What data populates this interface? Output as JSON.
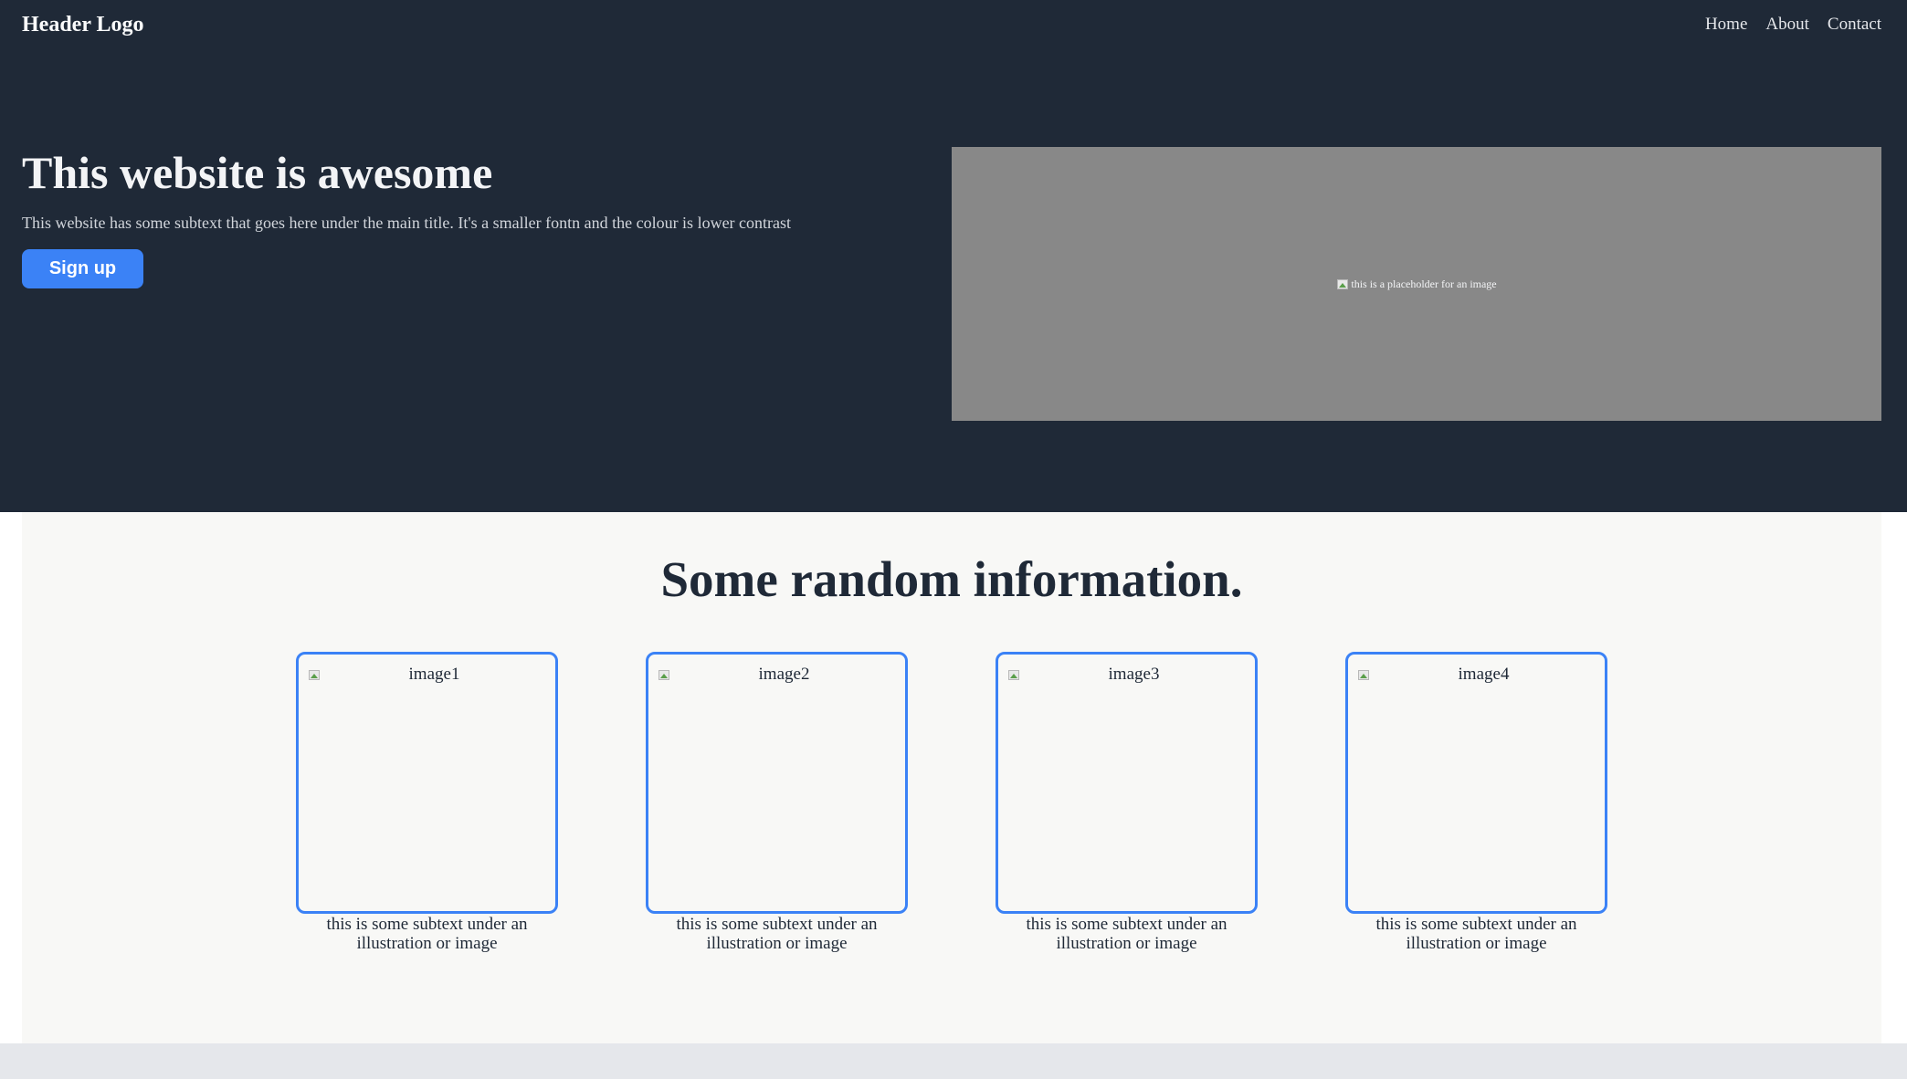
{
  "header": {
    "logo": "Header Logo",
    "nav": [
      "Home",
      "About",
      "Contact"
    ]
  },
  "hero": {
    "title": "This website is awesome",
    "subtitle": "This website has some subtext that goes here under the main title. It's a smaller fontn and the colour is lower contrast",
    "cta_label": "Sign up",
    "image_alt": "this is a placeholder for an image"
  },
  "info": {
    "title": "Some random information.",
    "cards": [
      {
        "image_alt": "image1",
        "caption": "this is some subtext under an illustration or image"
      },
      {
        "image_alt": "image2",
        "caption": "this is some subtext under an illustration or image"
      },
      {
        "image_alt": "image3",
        "caption": "this is some subtext under an illustration or image"
      },
      {
        "image_alt": "image4",
        "caption": "this is some subtext under an illustration or image"
      }
    ]
  },
  "colors": {
    "hero_background": "#1f2937",
    "accent": "#3b82f6",
    "info_background": "#f8f8f6",
    "image_placeholder": "#888888"
  },
  "icons": {
    "broken_image": "broken-image-icon"
  }
}
